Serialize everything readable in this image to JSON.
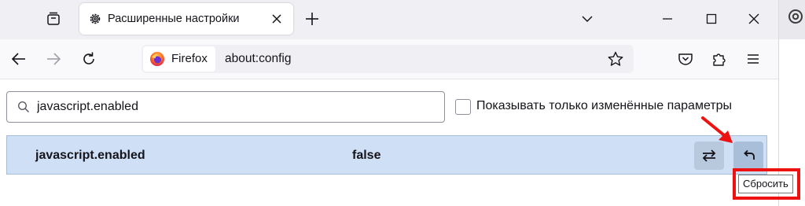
{
  "tab": {
    "title": "Расширенные настройки"
  },
  "urlbar": {
    "identity_label": "Firefox",
    "url": "about:config"
  },
  "search": {
    "value": "javascript.enabled"
  },
  "filter": {
    "label": "Показывать только изменённые параметры",
    "checked": false
  },
  "pref": {
    "name": "javascript.enabled",
    "value": "false"
  },
  "tooltip": {
    "text": "Сбросить"
  },
  "icons": {
    "list_all_tabs": "tab-list-icon",
    "tab_favicon": "gear-icon",
    "close_tab": "close-icon",
    "new_tab": "plus-icon",
    "back": "back-arrow-icon",
    "forward": "forward-arrow-icon",
    "reload": "reload-icon",
    "bookmark": "star-icon",
    "pocket": "pocket-icon",
    "extensions": "puzzle-icon",
    "menu": "hamburger-icon",
    "toggle": "toggle-icon",
    "reset": "undo-icon"
  },
  "colors": {
    "row_highlight": "#cfe0f6",
    "annotation": "#ee1111"
  }
}
